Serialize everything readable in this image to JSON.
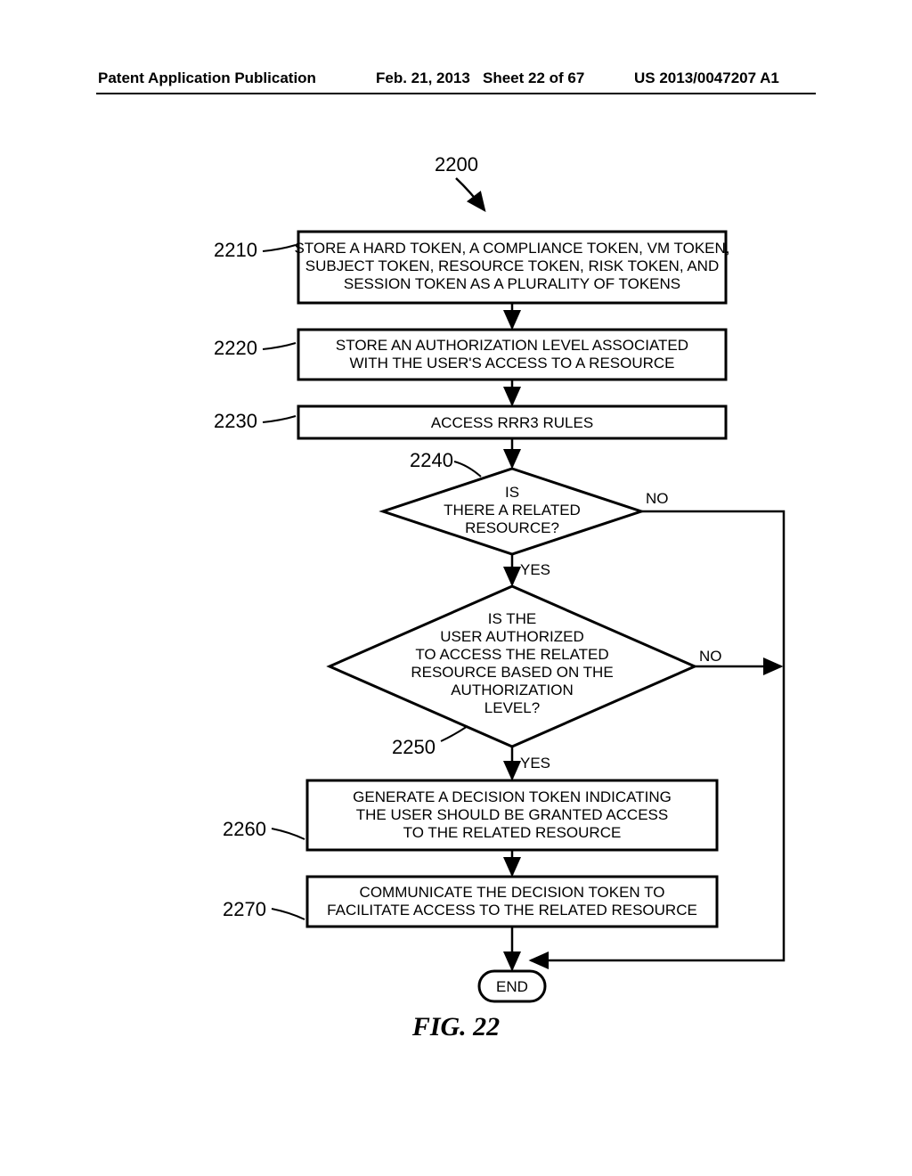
{
  "header": {
    "pub": "Patent Application Publication",
    "date": "Feb. 21, 2013",
    "sheet": "Sheet 22 of 67",
    "docnum": "US 2013/0047207 A1"
  },
  "figure": {
    "ref_main": "2200",
    "caption": "FIG. 22",
    "steps": {
      "s2210": {
        "ref": "2210",
        "line1": "STORE A HARD TOKEN, A COMPLIANCE TOKEN, VM TOKEN,",
        "line2": "SUBJECT TOKEN, RESOURCE TOKEN, RISK TOKEN, AND",
        "line3": "SESSION TOKEN AS A PLURALITY OF TOKENS"
      },
      "s2220": {
        "ref": "2220",
        "line1": "STORE AN AUTHORIZATION LEVEL ASSOCIATED",
        "line2": "WITH THE USER'S ACCESS TO A RESOURCE"
      },
      "s2230": {
        "ref": "2230",
        "line1": "ACCESS RRR3 RULES"
      },
      "s2240": {
        "ref": "2240",
        "line1": "IS",
        "line2": "THERE A RELATED",
        "line3": "RESOURCE?"
      },
      "s2250": {
        "ref": "2250",
        "line1": "IS THE",
        "line2": "USER AUTHORIZED",
        "line3": "TO ACCESS THE RELATED",
        "line4": "RESOURCE BASED ON THE",
        "line5": "AUTHORIZATION",
        "line6": "LEVEL?"
      },
      "s2260": {
        "ref": "2260",
        "line1": "GENERATE A DECISION TOKEN INDICATING",
        "line2": "THE USER SHOULD BE GRANTED ACCESS",
        "line3": "TO THE RELATED RESOURCE"
      },
      "s2270": {
        "ref": "2270",
        "line1": "COMMUNICATE THE DECISION TOKEN TO",
        "line2": "FACILITATE ACCESS TO THE RELATED RESOURCE"
      },
      "end": "END"
    },
    "labels": {
      "yes": "YES",
      "no": "NO"
    }
  }
}
